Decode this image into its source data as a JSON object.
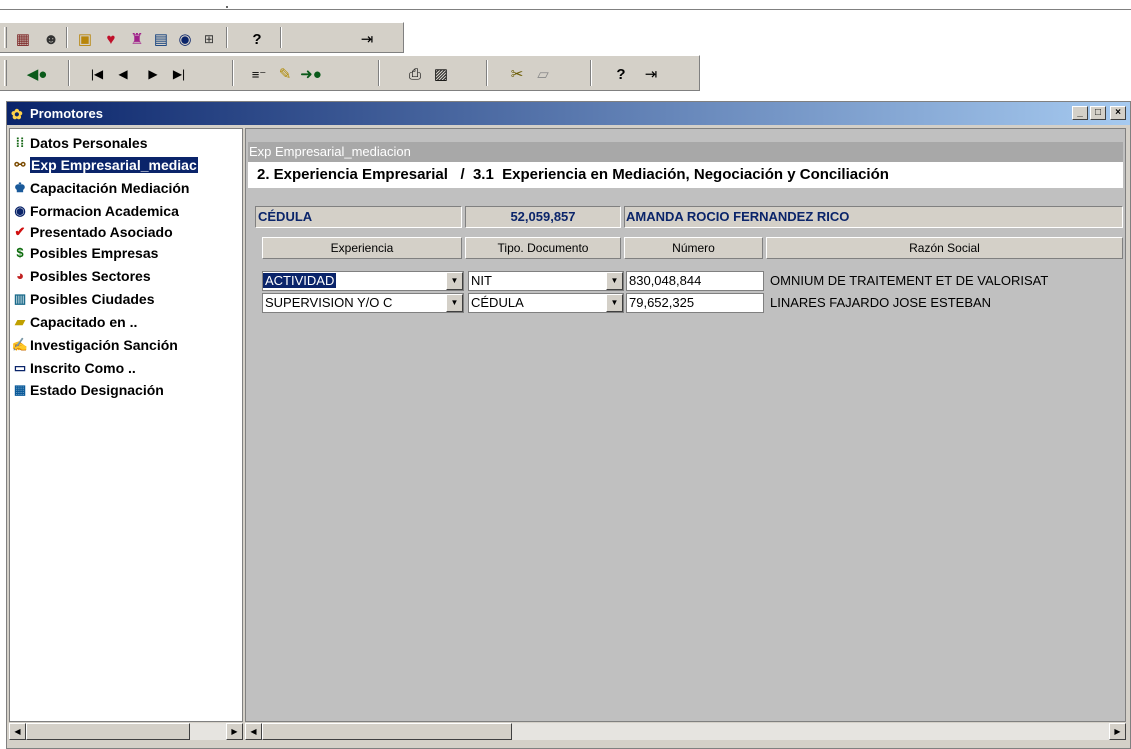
{
  "toolbar1": {
    "icons": [
      "grid-icon",
      "user-search-icon",
      "report-icon",
      "heart-badge-icon",
      "people-icon",
      "table-icon",
      "database-icon",
      "numeric-icon",
      "help-icon",
      "exit-icon"
    ]
  },
  "toolbar2": {
    "icons": [
      "back-icon",
      "first-record-icon",
      "prev-record-icon",
      "next-record-icon",
      "last-record-icon",
      "insert-record-icon",
      "edit-record-icon",
      "save-record-icon",
      "print-icon",
      "disk-icon",
      "cut-icon",
      "eraser-icon",
      "help-icon",
      "exit-icon"
    ]
  },
  "window": {
    "title": "Promotores",
    "min_label": "_",
    "max_label": "□",
    "close_label": "×"
  },
  "tree": {
    "items": [
      {
        "label": "Datos Personales",
        "icon": "grid-icon"
      },
      {
        "label": "Exp Empresarial_mediac",
        "icon": "tree-icon",
        "selected": true
      },
      {
        "label": "Capacitación Mediación",
        "icon": "people-icon"
      },
      {
        "label": "Formacion Academica",
        "icon": "database-icon"
      },
      {
        "label": "Presentado Asociado",
        "icon": "check-icon"
      },
      {
        "label": "Posibles Empresas",
        "icon": "money-icon"
      },
      {
        "label": "Posibles Sectores",
        "icon": "pie-icon"
      },
      {
        "label": "Posibles Ciudades",
        "icon": "city-icon"
      },
      {
        "label": "Capacitado en ..",
        "icon": "folder-icon"
      },
      {
        "label": "Investigación Sanción",
        "icon": "edit-doc-icon"
      },
      {
        "label": "Inscrito Como ..",
        "icon": "card-icon"
      },
      {
        "label": "Estado Designación",
        "icon": "table-icon"
      }
    ]
  },
  "panel": {
    "subtitle": "Exp Empresarial_mediacion",
    "heading": "2. Experiencia Empresarial   /  3.1  Experiencia en Mediación, Negociación y Conciliación",
    "id_label": "CÉDULA",
    "id_number": "52,059,857",
    "person_name": "AMANDA ROCIO FERNANDEZ RICO",
    "columns": [
      "Experiencia",
      "Tipo. Documento",
      "Número",
      "Razón Social"
    ],
    "rows": [
      {
        "experiencia": "ACTIVIDAD",
        "tipo": "NIT",
        "numero": "830,048,844",
        "razon": "OMNIUM DE TRAITEMENT ET DE VALORISAT"
      },
      {
        "experiencia": "SUPERVISION Y/O C",
        "tipo": "CÉDULA",
        "numero": "79,652,325",
        "razon": "LINARES FAJARDO JOSE ESTEBAN"
      }
    ]
  },
  "colors": {
    "title_bar": "#0a246a",
    "selection": "#0a246a",
    "face": "#d4d0c8"
  }
}
